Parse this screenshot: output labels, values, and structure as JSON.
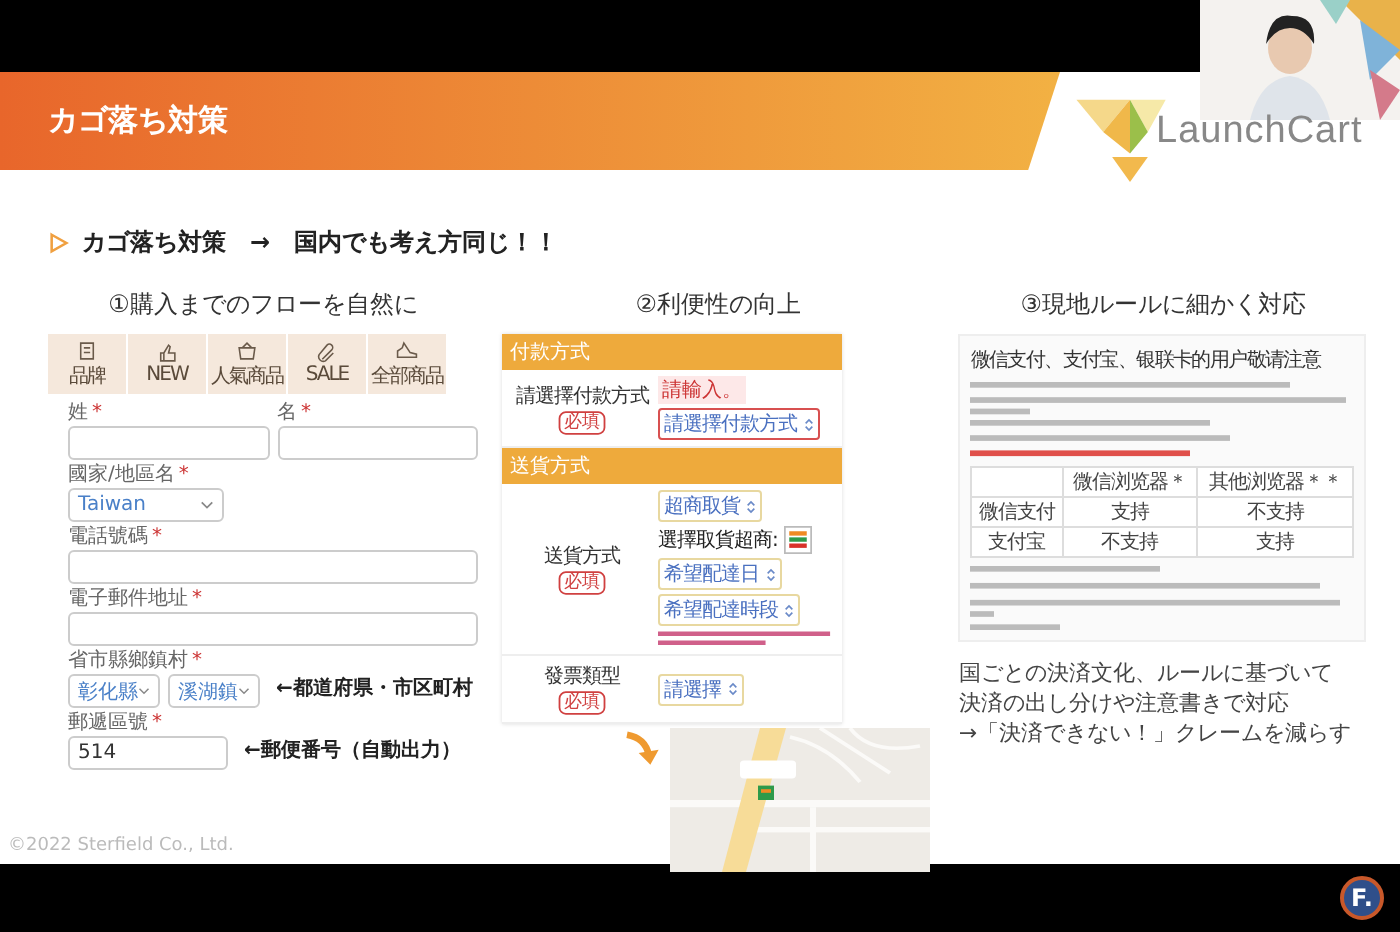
{
  "header": {
    "title": "カゴ落ち対策",
    "logo_text": "LaunchCart"
  },
  "headline": "カゴ落ち対策　→　国内でも考え方同じ！！",
  "columns": [
    {
      "heading": "①購入までのフローを自然に"
    },
    {
      "heading": "②利便性の向上"
    },
    {
      "heading": "③現地ルールに細かく対応"
    }
  ],
  "shop_nav": [
    {
      "label": "品牌"
    },
    {
      "label": "NEW"
    },
    {
      "label": "人氣商品"
    },
    {
      "label": "SALE"
    },
    {
      "label": "全部商品"
    }
  ],
  "form_rows": [
    {
      "fields": [
        {
          "label": "姓",
          "mark": "*",
          "kind": "text"
        },
        {
          "label": "名",
          "mark": "*",
          "kind": "text"
        }
      ]
    },
    {
      "fields": [
        {
          "label": "國家/地區名",
          "mark": "*",
          "kind": "select",
          "value": "Taiwan"
        }
      ]
    },
    {
      "fields": [
        {
          "label": "電話號碼",
          "mark": "*",
          "kind": "text"
        }
      ]
    },
    {
      "fields": [
        {
          "label": "電子郵件地址",
          "mark": "*",
          "kind": "text"
        }
      ]
    },
    {
      "fields": [
        {
          "label": "省市縣鄉鎮村",
          "mark": "*",
          "kind": "select",
          "value": "彰化縣"
        },
        {
          "kind": "select",
          "value": "溪湖鎮"
        }
      ],
      "note": "←都道府県・市区町村"
    },
    {
      "fields": [
        {
          "label": "郵遞區號",
          "mark": "*",
          "kind": "text",
          "value": "514"
        }
      ],
      "note": "←郵便番号（自動出力）"
    }
  ],
  "checkout": {
    "sections": [
      {
        "title": "付款方式",
        "rows": [
          {
            "label": "請選擇付款方式",
            "badge": "必填",
            "tooltip": "請輸入。",
            "controls": [
              {
                "kind": "select",
                "value": "請選擇付款方式",
                "error": true
              }
            ]
          }
        ]
      },
      {
        "title": "送貨方式",
        "rows": [
          {
            "label": "送貨方式",
            "badge": "必填",
            "controls": [
              {
                "kind": "select",
                "value": "超商取貨",
                "error": false
              },
              {
                "kind": "store",
                "label": "選擇取貨超商:"
              },
              {
                "kind": "select",
                "value": "希望配達日",
                "error": false
              },
              {
                "kind": "select",
                "value": "希望配達時段",
                "error": false
              },
              {
                "kind": "note"
              }
            ]
          }
        ]
      },
      {
        "rows": [
          {
            "label": "發票類型",
            "badge": "必填",
            "controls": [
              {
                "kind": "select",
                "value": "請選擇",
                "error": false
              }
            ]
          }
        ]
      }
    ]
  },
  "notice": {
    "title": "微信支付、支付宝、银联卡的用户敬请注意",
    "table": {
      "columns": [
        "微信浏览器＊",
        "其他浏览器＊＊"
      ],
      "rows": [
        {
          "label": "微信支付",
          "cells": [
            "支持",
            "不支持"
          ]
        },
        {
          "label": "支付宝",
          "cells": [
            "不支持",
            "支持"
          ]
        }
      ]
    }
  },
  "summary": [
    "国ごとの決済文化、ルールに基づいて",
    "決済の出し分けや注意書きで対応",
    "→「決済できない！」クレームを減らす"
  ],
  "copyright": "©2022 Sterfield Co., Ltd.",
  "brand_mark": "F."
}
